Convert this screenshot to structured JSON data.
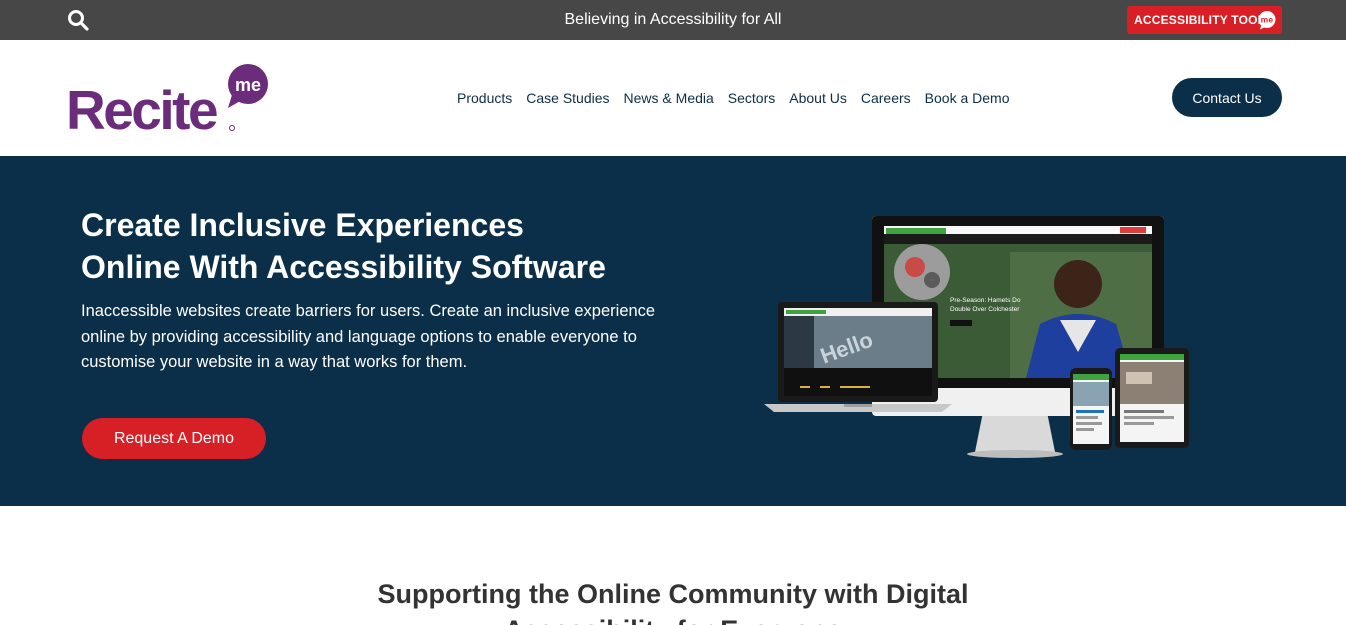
{
  "topbar": {
    "tagline": "Believing in Accessibility for All",
    "accessibility_tools_label": "ACCESSIBILITY TOOLS",
    "accessibility_badge_text": "me",
    "search_icon": "search-icon"
  },
  "header": {
    "logo_text": "Recite",
    "logo_badge_text": "me",
    "nav": [
      "Products",
      "Case Studies",
      "News & Media",
      "Sectors",
      "About Us",
      "Careers",
      "Book a Demo"
    ],
    "contact_label": "Contact Us"
  },
  "hero": {
    "title_line1": "Create Inclusive Experiences",
    "title_line2": "Online With Accessibility Software",
    "description": "Inaccessible websites create barriers for users. Create an inclusive experience online by providing accessibility and language options to enable everyone to customise your website in a way that works for them.",
    "cta_label": "Request A Demo",
    "monitor_headline_line1": "Pre-Season: Hamets Do",
    "monitor_headline_line2": "Double Over Colchester",
    "laptop_screen_text": "Hello"
  },
  "section": {
    "title": "Supporting the Online Community with Digital Accessibility for Everyone"
  },
  "colors": {
    "brand_purple": "#6b2c7b",
    "navy": "#0b2f48",
    "red": "#d71f26",
    "topbar": "#474747"
  }
}
